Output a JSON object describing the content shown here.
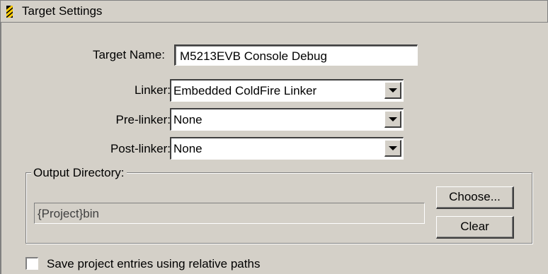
{
  "title": "Target Settings",
  "target_name": {
    "label": "Target Name:",
    "value": "M5213EVB Console Debug"
  },
  "linker": {
    "label": "Linker:",
    "value": "Embedded ColdFire Linker"
  },
  "pre_linker": {
    "label": "Pre-linker:",
    "value": "None"
  },
  "post_linker": {
    "label": "Post-linker:",
    "value": "None"
  },
  "output_directory": {
    "label": "Output Directory:",
    "value": "{Project}bin",
    "choose_label": "Choose...",
    "clear_label": "Clear"
  },
  "relative_paths": {
    "label": "Save project entries using relative paths",
    "checked": false
  },
  "icons": {
    "title_icon": "target-settings-icon",
    "dropdown": "chevron-down-icon"
  }
}
